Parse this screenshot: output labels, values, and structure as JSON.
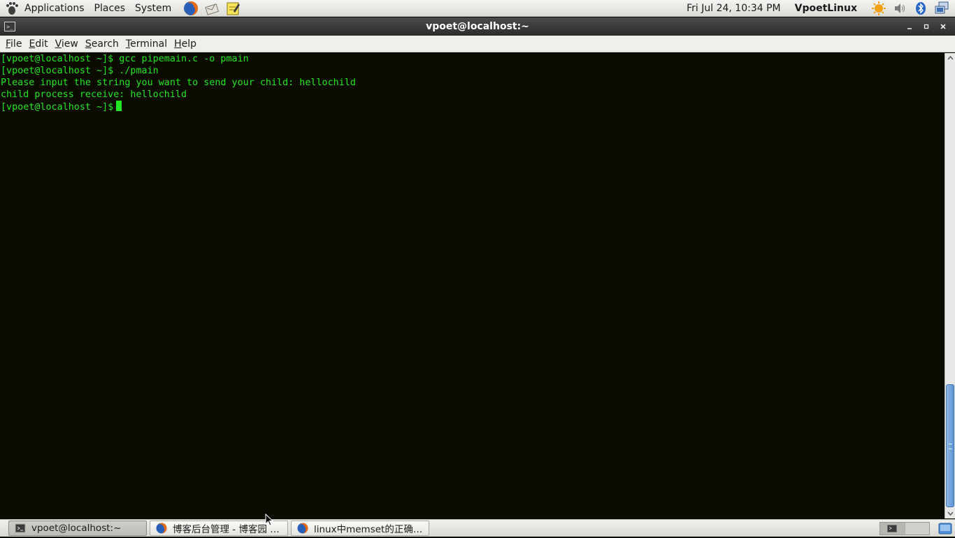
{
  "top_panel": {
    "menus": [
      "Applications",
      "Places",
      "System"
    ],
    "launchers": [
      "firefox-icon",
      "mail-icon",
      "notes-icon"
    ],
    "clock": "Fri Jul 24, 10:34 PM",
    "user": "VpoetLinux",
    "tray": [
      "update-icon",
      "volume-icon",
      "bluetooth-icon",
      "network-icon"
    ]
  },
  "window": {
    "title": "vpoet@localhost:~"
  },
  "menubar": {
    "items": [
      {
        "label_first": "F",
        "label_rest": "ile"
      },
      {
        "label_first": "E",
        "label_rest": "dit"
      },
      {
        "label_first": "V",
        "label_rest": "iew"
      },
      {
        "label_first": "S",
        "label_rest": "earch"
      },
      {
        "label_first": "T",
        "label_rest": "erminal"
      },
      {
        "label_first": "H",
        "label_rest": "elp"
      }
    ]
  },
  "terminal": {
    "lines": [
      "[vpoet@localhost ~]$ gcc pipemain.c -o pmain",
      "[vpoet@localhost ~]$ ./pmain",
      "Please input the string you want to send your child: hellochild",
      "child process receive: hellochild"
    ],
    "prompt": "[vpoet@localhost ~]$",
    "text_color": "#23e623",
    "background": "#0b0b00"
  },
  "taskbar": {
    "tasks": [
      {
        "label": "vpoet@localhost:~",
        "icon": "terminal-icon",
        "active": true
      },
      {
        "label": "博客后台管理 - 博客园 - …",
        "icon": "firefox-icon",
        "active": false
      },
      {
        "label": "linux中memset的正确…",
        "icon": "firefox-icon",
        "active": false
      }
    ]
  }
}
